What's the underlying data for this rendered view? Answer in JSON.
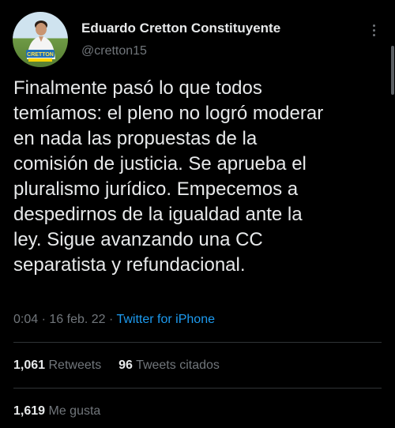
{
  "profile": {
    "display_name": "Eduardo Cretton Constituyente",
    "handle": "@cretton15",
    "avatar_badge": "CRETTON"
  },
  "tweet": {
    "text": "Finalmente pasó lo que todos\ntemíamos: el pleno no logró moderar\nen nada las propuestas de la\ncomisión de justicia. Se aprueba el\npluralismo jurídico. Empecemos a\ndespedirnos de la igualdad ante la\nley. Sigue avanzando una CC\nseparatista y refundacional.",
    "time": "0:04",
    "date": "16 feb. 22",
    "separator": "·",
    "source": "Twitter for iPhone"
  },
  "stats": {
    "retweets_count": "1,061",
    "retweets_label": "Retweets",
    "quotes_count": "96",
    "quotes_label": "Tweets citados",
    "likes_count": "1,619",
    "likes_label": "Me gusta"
  },
  "colors": {
    "background": "#000000",
    "text_primary": "#e7e9ea",
    "text_secondary": "#71767b",
    "link": "#1d9bf0",
    "divider": "#2f3336"
  },
  "icons": {
    "more": "more-vertical-icon"
  }
}
